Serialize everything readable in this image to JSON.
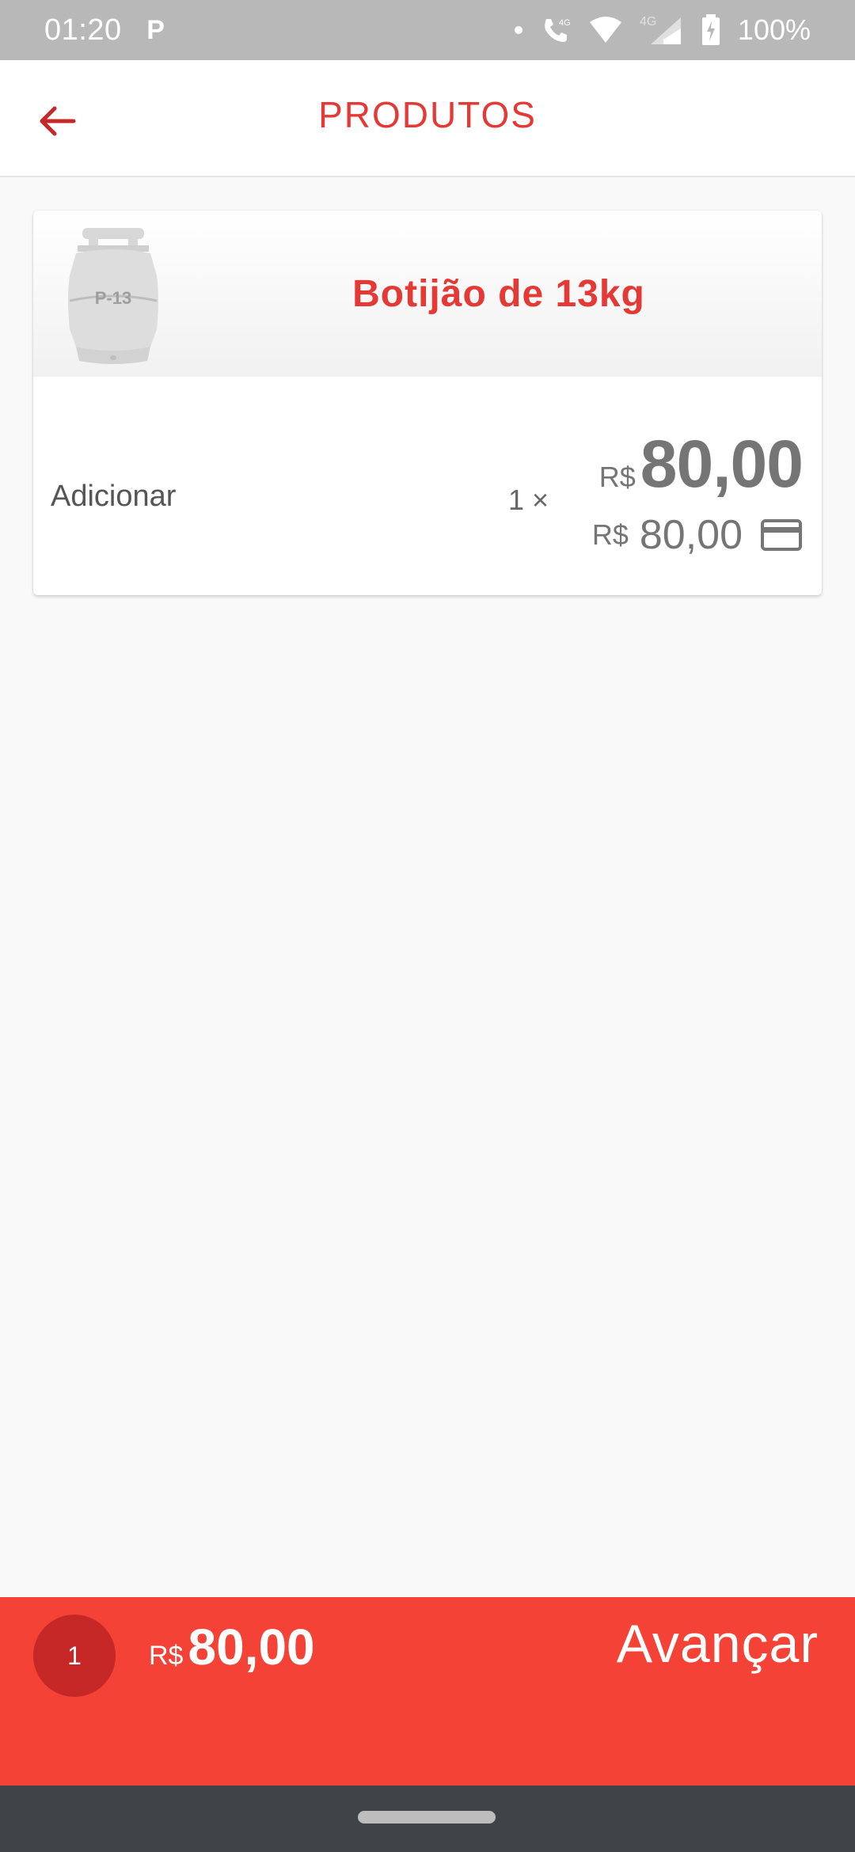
{
  "status_bar": {
    "time": "01:20",
    "carrier_icon": "P",
    "signal_label": "4G",
    "signal_label_2": "4G",
    "battery": "100%",
    "icons": [
      "dot-icon",
      "wifi-calling-icon",
      "wifi-icon",
      "cell-signal-icon",
      "battery-charging-icon"
    ]
  },
  "app_bar": {
    "title": "PRODUTOS",
    "back_icon": "arrow-left-icon"
  },
  "product": {
    "name": "Botijão de 13kg",
    "image_label": "P-13",
    "add_label": "Adicionar",
    "quantity": "1 ×",
    "price_currency": "R$",
    "price_value": "80,00",
    "card_price_currency": "R$",
    "card_price_value": "80,00",
    "card_icon": "credit-card-icon"
  },
  "checkout": {
    "item_count": "1",
    "total_currency": "R$",
    "total_value": "80,00",
    "advance_label": "Avançar"
  },
  "colors": {
    "accent": "#e53935",
    "checkout_bg": "#f44336",
    "badge_bg": "#c62828",
    "status_bar_bg": "#b8b8b8",
    "nav_bar_bg": "#3f4448"
  }
}
